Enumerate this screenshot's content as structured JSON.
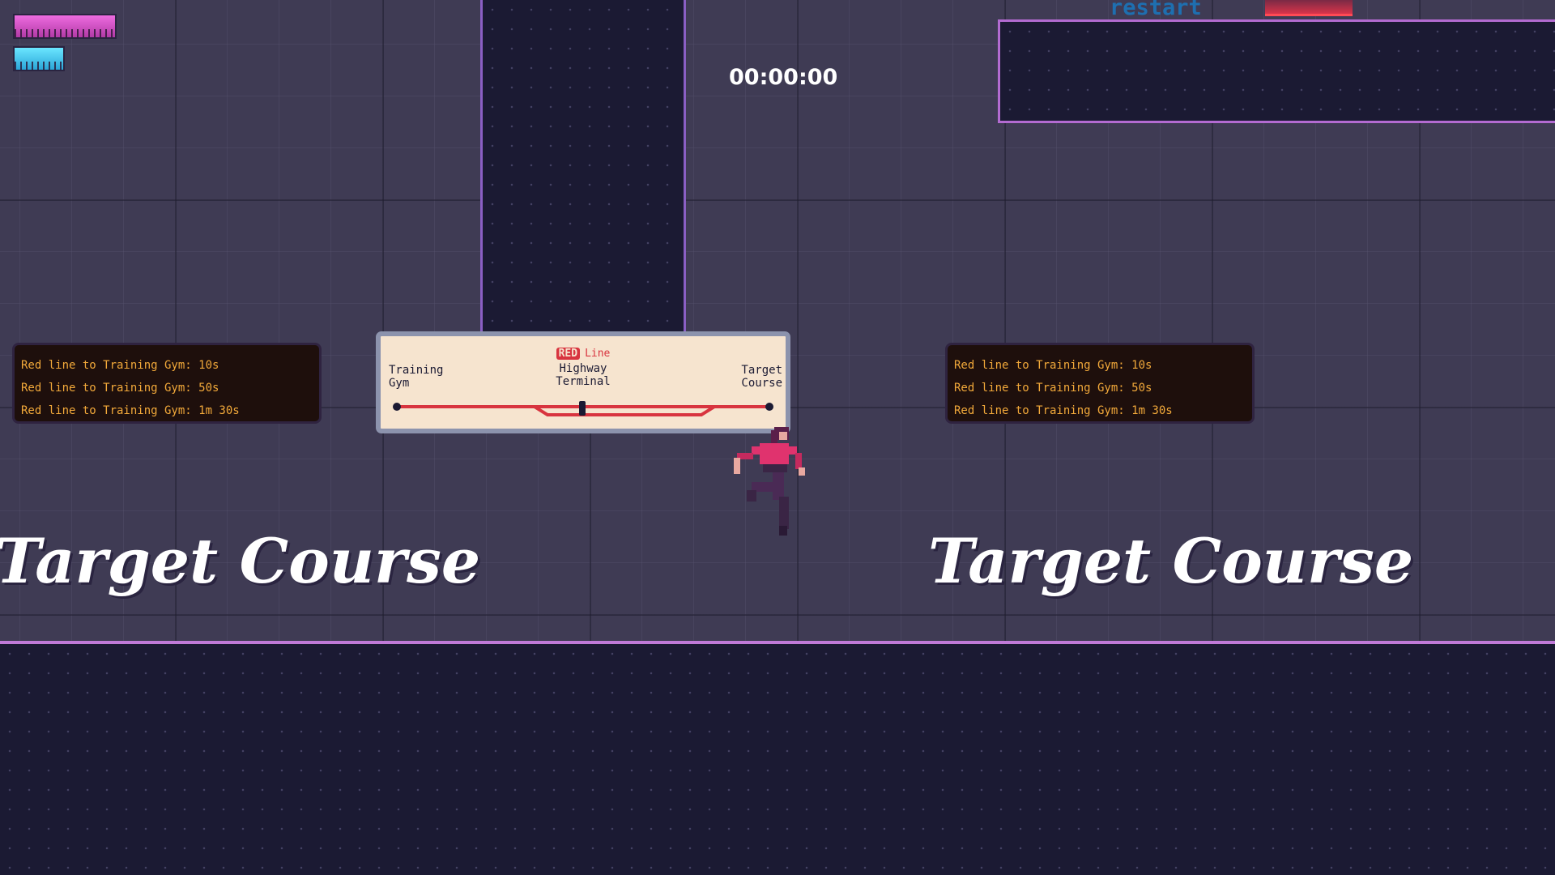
{
  "hud": {
    "timer": "00:00:00",
    "restart_label": "restart",
    "health_fraction": 1.0,
    "stamina_fraction": 1.0,
    "health_color": "#e45fd8",
    "stamina_color": "#4fd3f5"
  },
  "boards": {
    "left": {
      "lines": [
        "Red line to Training Gym: 10s",
        "Red line to Training Gym: 50s",
        "Red line to Training Gym: 1m 30s"
      ]
    },
    "right": {
      "lines": [
        "Red line to Training Gym: 10s",
        "Red line to Training Gym: 50s",
        "Red line to Training Gym: 1m 30s"
      ]
    }
  },
  "station_sign": {
    "badge": "RED",
    "line_label": "Line",
    "stations": {
      "left": [
        "Training",
        "Gym"
      ],
      "middle": [
        "Highway",
        "Terminal"
      ],
      "right": [
        "Target",
        "Course"
      ]
    },
    "line_color": "#d8343f"
  },
  "titles": {
    "left": "Target Course",
    "right": "Target Course"
  },
  "colors": {
    "background": "#3f3b54",
    "platform": "#1b1a33",
    "platform_edge": "#b36bd1",
    "board_text": "#f2a93a"
  },
  "icons": {
    "player": "player-character"
  }
}
